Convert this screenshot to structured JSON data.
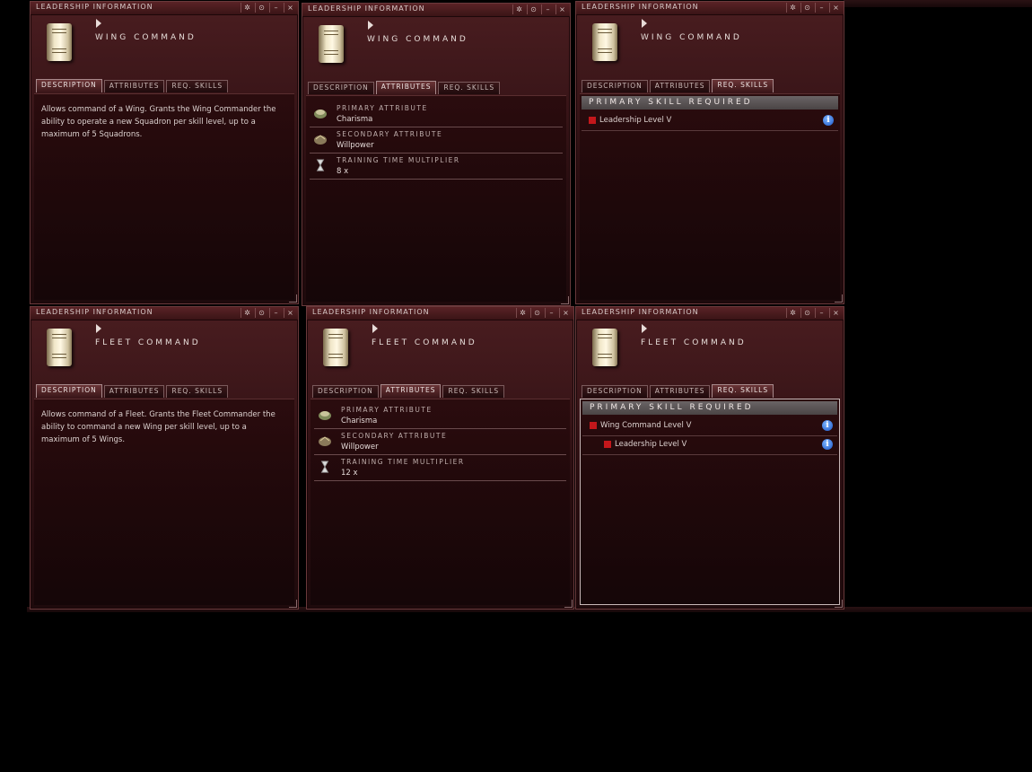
{
  "windows": [
    {
      "title": "LEADERSHIP INFORMATION",
      "skill": "WING COMMAND",
      "active_tab": 0,
      "description": "Allows command of a Wing. Grants the Wing Commander the ability to operate a new Squadron per skill level, up to a maximum of 5 Squadrons."
    },
    {
      "title": "LEADERSHIP INFORMATION",
      "skill": "WING COMMAND",
      "active_tab": 1,
      "attributes": [
        {
          "label": "PRIMARY ATTRIBUTE",
          "value": "Charisma",
          "icon": "charisma-icon"
        },
        {
          "label": "SECONDARY ATTRIBUTE",
          "value": "Willpower",
          "icon": "willpower-icon"
        },
        {
          "label": "TRAINING TIME MULTIPLIER",
          "value": "8 x",
          "icon": "hourglass-icon"
        }
      ]
    },
    {
      "title": "LEADERSHIP INFORMATION",
      "skill": "WING COMMAND",
      "active_tab": 2,
      "req_header": "PRIMARY SKILL REQUIRED",
      "req": [
        "Leadership Level V"
      ]
    },
    {
      "title": "LEADERSHIP INFORMATION",
      "skill": "FLEET COMMAND",
      "active_tab": 0,
      "description": "Allows command of a Fleet. Grants the Fleet Commander the ability to command a new Wing per skill level, up to a maximum of 5 Wings."
    },
    {
      "title": "LEADERSHIP INFORMATION",
      "skill": "FLEET COMMAND",
      "active_tab": 1,
      "attributes": [
        {
          "label": "PRIMARY ATTRIBUTE",
          "value": "Charisma",
          "icon": "charisma-icon"
        },
        {
          "label": "SECONDARY ATTRIBUTE",
          "value": "Willpower",
          "icon": "willpower-icon"
        },
        {
          "label": "TRAINING TIME MULTIPLIER",
          "value": "12 x",
          "icon": "hourglass-icon"
        }
      ]
    },
    {
      "title": "LEADERSHIP INFORMATION",
      "skill": "FLEET COMMAND",
      "active_tab": 2,
      "req_header": "PRIMARY SKILL REQUIRED",
      "req": [
        "Wing Command Level V",
        "Leadership Level V"
      ]
    }
  ],
  "tabs": [
    "DESCRIPTION",
    "ATTRIBUTES",
    "REQ. SKILLS"
  ],
  "controls": [
    "✲",
    "⊙",
    "–",
    "×"
  ],
  "colors": {
    "accent": "#c4171b",
    "info": "#1a55c8"
  }
}
